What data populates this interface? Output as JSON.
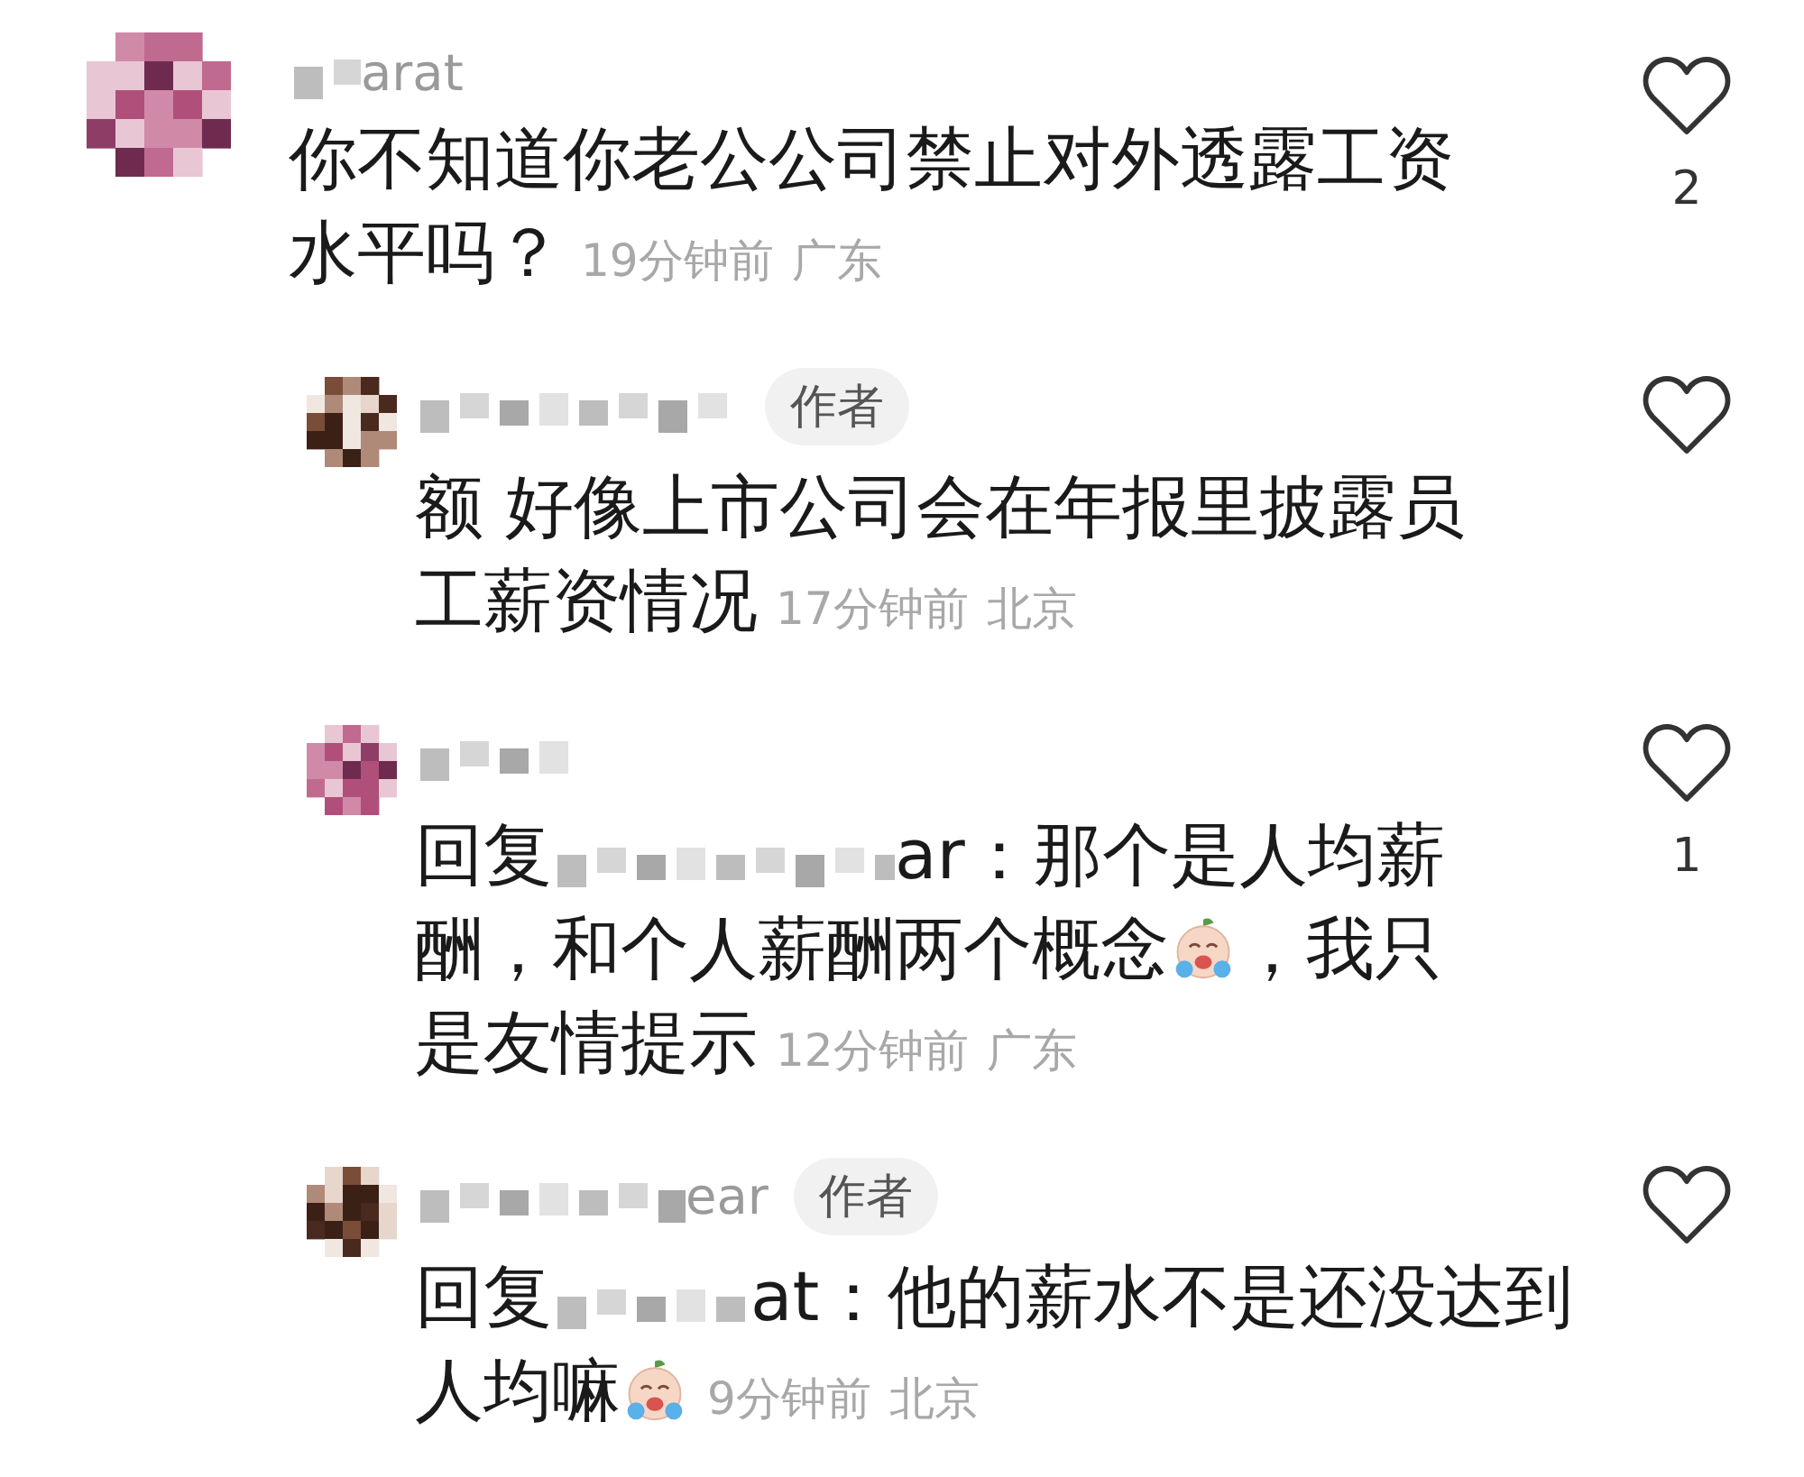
{
  "comments": [
    {
      "kind": "top",
      "name": "arat",
      "author": false,
      "lines": [
        [
          {
            "kind": "text",
            "text": "你不知道你老公公司禁止对外透露工资"
          }
        ],
        [
          {
            "kind": "text",
            "text": "水平吗？"
          }
        ]
      ],
      "time": "19分钟前",
      "location": "广东",
      "likes": "2"
    },
    {
      "kind": "reply",
      "author_badge": "作者",
      "author": true,
      "lines": [
        [
          {
            "kind": "text",
            "text": "额 好像上市公司会在年报里披露员"
          }
        ],
        [
          {
            "kind": "text",
            "text": "工薪资情况"
          }
        ]
      ],
      "time": "17分钟前",
      "location": "北京"
    },
    {
      "kind": "reply",
      "author": false,
      "lines": [
        [
          {
            "kind": "text",
            "text": "回复"
          },
          {
            "kind": "blur"
          },
          {
            "kind": "text",
            "text": "ar：那个是人均薪"
          }
        ],
        [
          {
            "kind": "text",
            "text": "酬，和个人薪酬两个概念"
          },
          {
            "kind": "emoji"
          },
          {
            "kind": "text",
            "text": "，我只"
          }
        ],
        [
          {
            "kind": "text",
            "text": "是友情提示"
          }
        ]
      ],
      "time": "12分钟前",
      "location": "广东",
      "likes": "1"
    },
    {
      "kind": "reply",
      "name": "ear",
      "author_badge": "作者",
      "author": true,
      "lines": [
        [
          {
            "kind": "text",
            "text": "回复"
          },
          {
            "kind": "blur"
          },
          {
            "kind": "text",
            "text": "at：他的薪水不是还没达到"
          }
        ],
        [
          {
            "kind": "text",
            "text": "人均嘛"
          },
          {
            "kind": "emoji"
          }
        ]
      ],
      "time": "9分钟前",
      "location": "北京"
    }
  ]
}
